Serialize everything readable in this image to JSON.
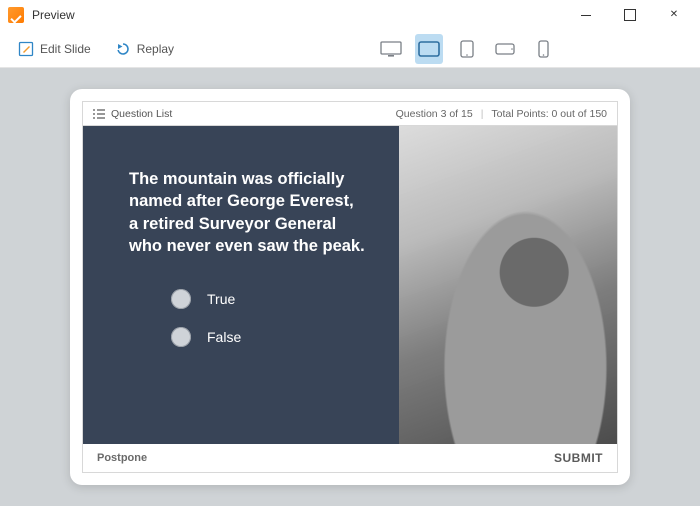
{
  "window": {
    "title": "Preview"
  },
  "toolbar": {
    "edit_label": "Edit Slide",
    "replay_label": "Replay"
  },
  "slide": {
    "header": {
      "question_list_label": "Question List",
      "question_counter": "Question 3 of 15",
      "points": "Total Points: 0 out of 150"
    },
    "question": {
      "lines": [
        "The mountain was officially",
        "named after George Everest,",
        "a retired Surveyor General",
        "who never even saw the peak."
      ]
    },
    "answers": {
      "option_true": "True",
      "option_false": "False"
    },
    "footer": {
      "postpone_label": "Postpone",
      "submit_label": "SUBMIT"
    }
  }
}
